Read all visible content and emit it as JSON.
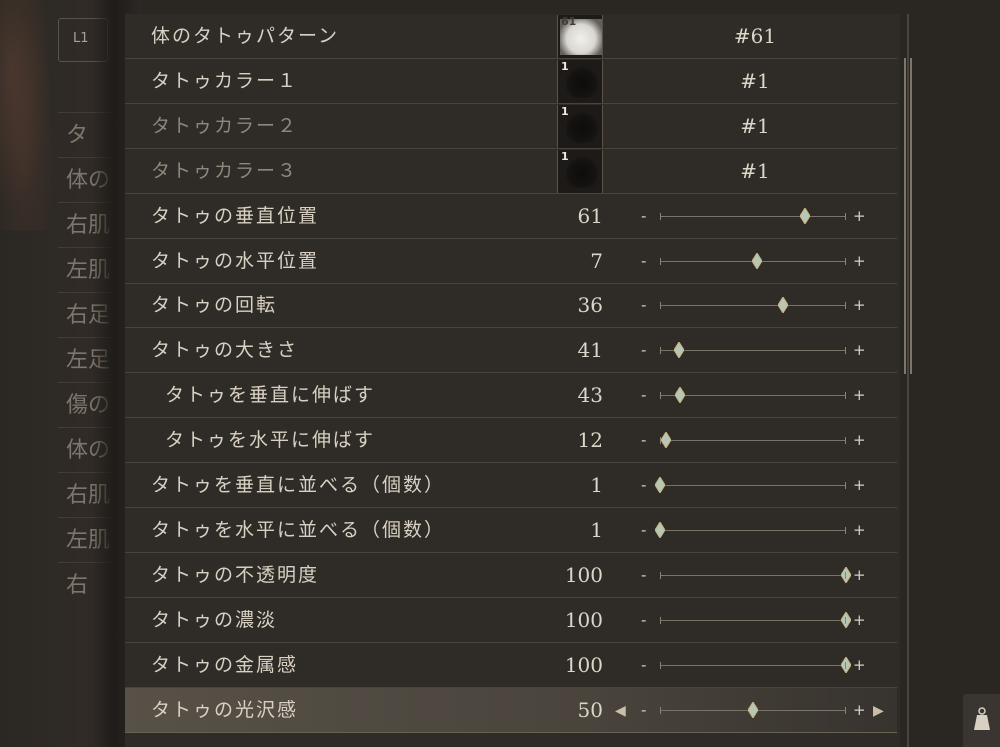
{
  "left_menu": {
    "l1_label": "L1",
    "items": [
      "タ",
      "体の",
      "右肌",
      "左肌",
      "右足",
      "左足",
      "傷の",
      "体の",
      "右肌",
      "左肌",
      "右"
    ]
  },
  "rows": [
    {
      "type": "pattern",
      "label": "体のタトゥパターン",
      "swatch_num": "61",
      "swatch_style": "light",
      "value": "#61",
      "dim": false
    },
    {
      "type": "pattern",
      "label": "タトゥカラー１",
      "swatch_num": "1",
      "swatch_style": "dark",
      "value": "#1",
      "dim": false
    },
    {
      "type": "pattern",
      "label": "タトゥカラー２",
      "swatch_num": "1",
      "swatch_style": "dark",
      "value": "#1",
      "dim": true
    },
    {
      "type": "pattern",
      "label": "タトゥカラー３",
      "swatch_num": "1",
      "swatch_style": "dark",
      "value": "#1",
      "dim": true
    },
    {
      "type": "slider",
      "label": "タトゥの垂直位置",
      "value": "61",
      "level": 0.78
    },
    {
      "type": "slider",
      "label": "タトゥの水平位置",
      "value": "7",
      "level": 0.52
    },
    {
      "type": "slider",
      "label": "タトゥの回転",
      "value": "36",
      "level": 0.66
    },
    {
      "type": "slider",
      "label": "タトゥの大きさ",
      "value": "41",
      "level": 0.1
    },
    {
      "type": "slider",
      "label": "タトゥを垂直に伸ばす",
      "value": "43",
      "level": 0.11,
      "indent": true
    },
    {
      "type": "slider",
      "label": "タトゥを水平に伸ばす",
      "value": "12",
      "level": 0.03,
      "indent": true
    },
    {
      "type": "slider",
      "label": "タトゥを垂直に並べる（個数）",
      "value": "1",
      "level": 0.0
    },
    {
      "type": "slider",
      "label": "タトゥを水平に並べる（個数）",
      "value": "1",
      "level": 0.0
    },
    {
      "type": "slider",
      "label": "タトゥの不透明度",
      "value": "100",
      "level": 1.0
    },
    {
      "type": "slider",
      "label": "タトゥの濃淡",
      "value": "100",
      "level": 1.0
    },
    {
      "type": "slider",
      "label": "タトゥの金属感",
      "value": "100",
      "level": 1.0
    },
    {
      "type": "slider",
      "label": "タトゥの光沢感",
      "value": "50",
      "level": 0.5,
      "selected": true
    }
  ],
  "slider_controls": {
    "minus": "-",
    "plus": "+",
    "arrow_left": "◀",
    "arrow_right": "▶"
  },
  "colors": {
    "thumb_fill": "#b6c7b8",
    "thumb_edge": "#c9b27a",
    "accent": "#c9bfa8"
  },
  "icons": {
    "corner": "weight-icon"
  }
}
